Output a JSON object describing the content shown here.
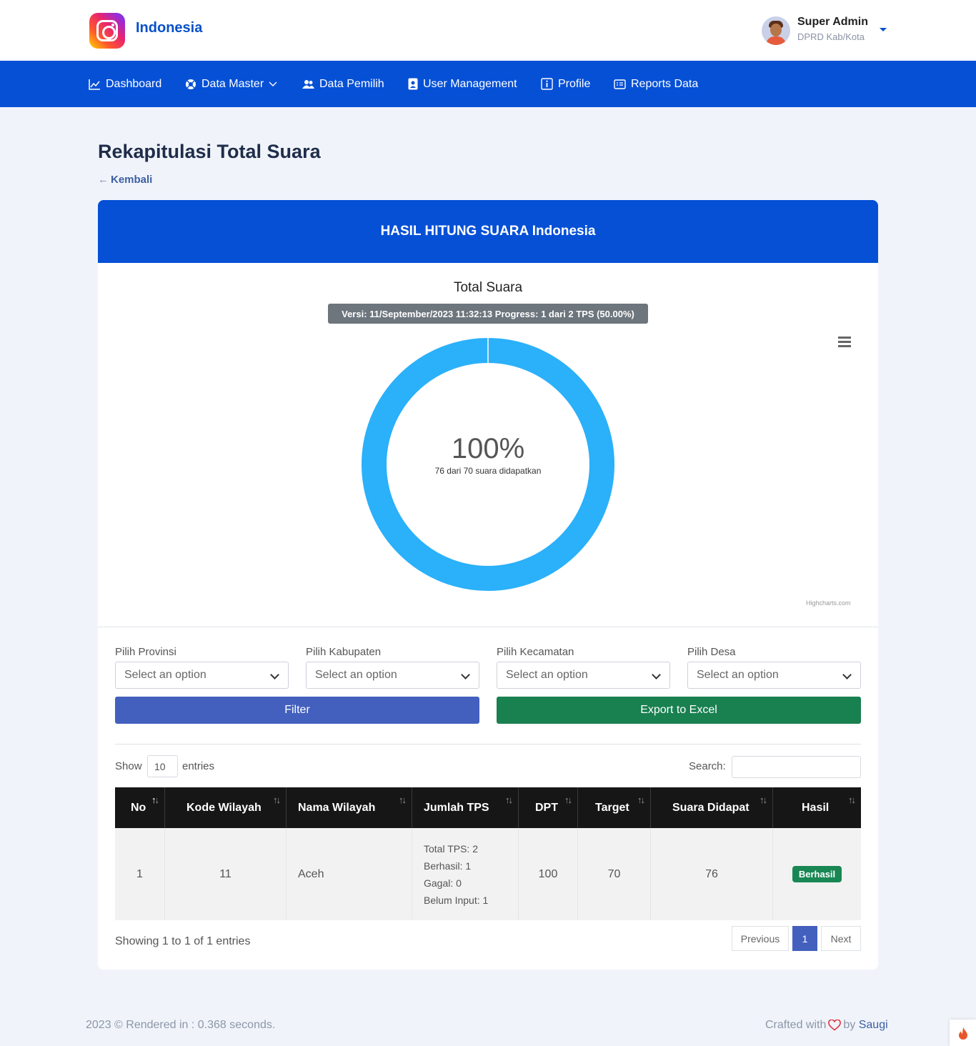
{
  "header": {
    "brand": "Indonesia",
    "user": {
      "name": "Super Admin",
      "role": "DPRD Kab/Kota"
    }
  },
  "nav": [
    {
      "label": "Dashboard",
      "icon": "chart-line-icon"
    },
    {
      "label": "Data Master",
      "icon": "lifebuoy-icon",
      "dropdown": true
    },
    {
      "label": "Data Pemilih",
      "icon": "users-icon"
    },
    {
      "label": "User Management",
      "icon": "id-badge-icon"
    },
    {
      "label": "Profile",
      "icon": "info-icon"
    },
    {
      "label": "Reports Data",
      "icon": "report-icon"
    }
  ],
  "page": {
    "title": "Rekapitulasi Total Suara",
    "back_label": "Kembali"
  },
  "card": {
    "title": "HASIL HITUNG SUARA Indonesia"
  },
  "chart_data": {
    "type": "pie",
    "title": "Total Suara",
    "subtitle": "Versi: 11/September/2023 11:32:13 Progress: 1 dari 2 TPS (50.00%)",
    "center_value": "100%",
    "center_caption": "76 dari 70 suara didapatkan",
    "slices": [
      {
        "value": 100,
        "color": "#2bb0fa"
      }
    ],
    "credit": "Highcharts.com"
  },
  "filters": {
    "provinsi": {
      "label": "Pilih Provinsi",
      "value": "Select an option"
    },
    "kabupaten": {
      "label": "Pilih Kabupaten",
      "value": "Select an option"
    },
    "kecamatan": {
      "label": "Pilih Kecamatan",
      "value": "Select an option"
    },
    "desa": {
      "label": "Pilih Desa",
      "value": "Select an option"
    },
    "filter_label": "Filter",
    "export_label": "Export to Excel"
  },
  "table": {
    "show_label": "Show",
    "page_size": "10",
    "entries_label": "entries",
    "search_label": "Search:",
    "columns": [
      "No",
      "Kode Wilayah",
      "Nama Wilayah",
      "Jumlah TPS",
      "DPT",
      "Target",
      "Suara Didapat",
      "Hasil"
    ],
    "rows": [
      {
        "no": "1",
        "kode": "11",
        "nama": "Aceh",
        "tps_total": "Total TPS: 2",
        "tps_berhasil": "Berhasil: 1",
        "tps_gagal": "Gagal: 0",
        "tps_belum": "Belum Input: 1",
        "dpt": "100",
        "target": "70",
        "suara": "76",
        "hasil": "Berhasil"
      }
    ],
    "info": "Showing 1 to 1 of 1 entries",
    "pagination": {
      "prev": "Previous",
      "current": "1",
      "next": "Next"
    }
  },
  "footer": {
    "left": "2023 © Rendered in : 0.368 seconds.",
    "crafted": "Crafted with",
    "by": "by",
    "author": "Saugi"
  },
  "colors": {
    "primary": "#0650d6",
    "filter_button": "#4360be",
    "export_button": "#198050",
    "badge_success": "#198754",
    "donut": "#2bb0fa"
  }
}
